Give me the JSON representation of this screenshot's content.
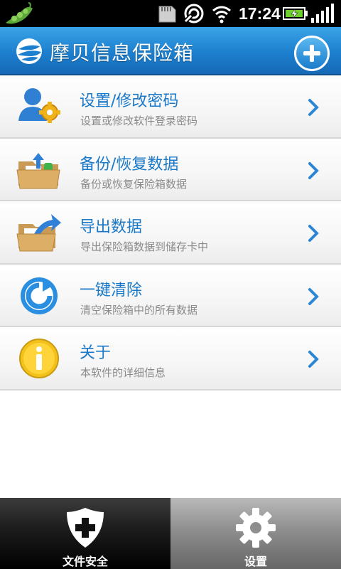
{
  "status_bar": {
    "time": "17:24",
    "icons": [
      "pea-app-icon",
      "sd-card-icon",
      "gps-icon",
      "wifi-icon",
      "battery-charging-icon",
      "signal-icon"
    ]
  },
  "header": {
    "title": "摩贝信息保险箱",
    "logo_icon": "app-logo-icon",
    "add_icon": "plus-circle-icon"
  },
  "menu": [
    {
      "label": "设置/修改密码",
      "desc": "设置或修改软件登录密码",
      "icon": "user-gear-icon"
    },
    {
      "label": "备份/恢复数据",
      "desc": "备份或恢复保险箱数据",
      "icon": "folder-backup-icon"
    },
    {
      "label": "导出数据",
      "desc": "导出保险箱数据到储存卡中",
      "icon": "folder-export-icon"
    },
    {
      "label": "一键清除",
      "desc": "清空保险箱中的所有数据",
      "icon": "refresh-circle-icon"
    },
    {
      "label": "关于",
      "desc": "本软件的详细信息",
      "icon": "info-icon"
    }
  ],
  "bottom_nav": {
    "tabs": [
      {
        "label": "文件安全",
        "icon": "shield-plus-icon",
        "selected": true
      },
      {
        "label": "设置",
        "icon": "gear-icon",
        "selected": false
      }
    ]
  },
  "colors": {
    "header_blue": "#1d7fcf",
    "label_blue": "#1a78c8",
    "desc_gray": "#8a8a8a"
  }
}
